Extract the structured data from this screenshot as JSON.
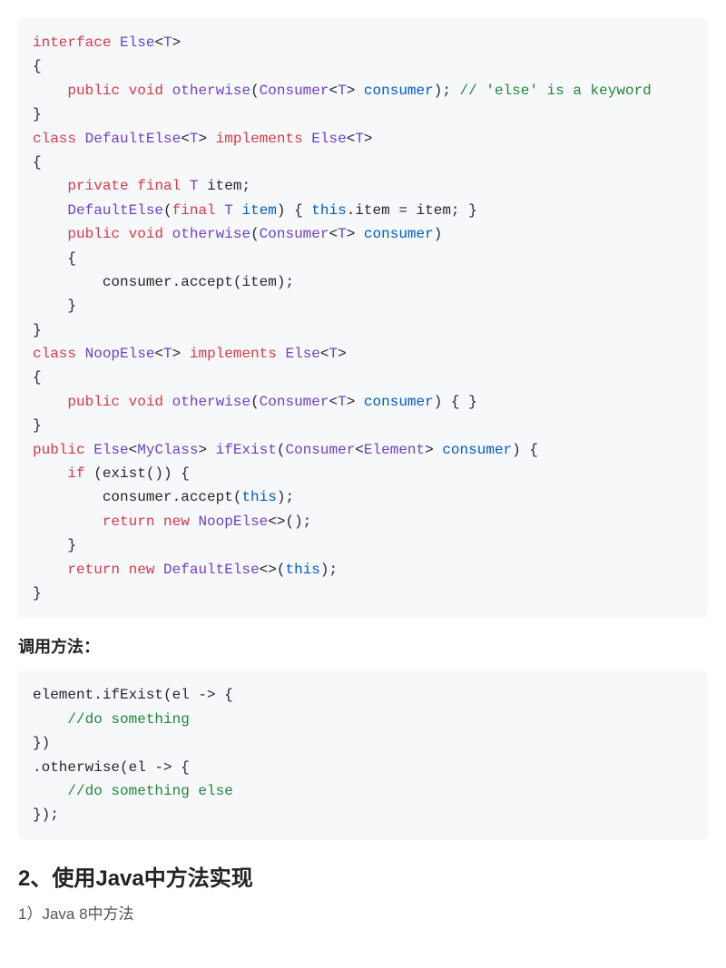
{
  "code1": {
    "l1": {
      "t1": "interface",
      "t2": " ",
      "t3": "Else",
      "t4": "<",
      "t5": "T",
      "t6": ">"
    },
    "l2": {
      "t1": "{"
    },
    "l3": {
      "t1": "    ",
      "t2": "public",
      "t3": " ",
      "t4": "void",
      "t5": " ",
      "t6": "otherwise",
      "t7": "(",
      "t8": "Consumer",
      "t9": "<",
      "t10": "T",
      "t11": "> ",
      "t12": "consumer",
      "t13": "); ",
      "t14": "// 'else' is a keyword"
    },
    "l4": {
      "t1": "}"
    },
    "l5": {
      "t1": "class",
      "t2": " ",
      "t3": "DefaultElse",
      "t4": "<",
      "t5": "T",
      "t6": "> ",
      "t7": "implements",
      "t8": " ",
      "t9": "Else",
      "t10": "<",
      "t11": "T",
      "t12": ">"
    },
    "l6": {
      "t1": "{"
    },
    "l7": {
      "t1": "    ",
      "t2": "private",
      "t3": " ",
      "t4": "final",
      "t5": " ",
      "t6": "T",
      "t7": " item;"
    },
    "l8": {
      "t1": "    ",
      "t2": "DefaultElse",
      "t3": "(",
      "t4": "final",
      "t5": " ",
      "t6": "T",
      "t7": " ",
      "t8": "item",
      "t9": ") { ",
      "t10": "this",
      "t11": ".item = item; }"
    },
    "l9": {
      "t1": "    ",
      "t2": "public",
      "t3": " ",
      "t4": "void",
      "t5": " ",
      "t6": "otherwise",
      "t7": "(",
      "t8": "Consumer",
      "t9": "<",
      "t10": "T",
      "t11": "> ",
      "t12": "consumer",
      "t13": ")"
    },
    "l10": {
      "t1": "    {"
    },
    "l11": {
      "t1": "        consumer.accept(item);"
    },
    "l12": {
      "t1": "    }"
    },
    "l13": {
      "t1": "}"
    },
    "l14": {
      "t1": "class",
      "t2": " ",
      "t3": "NoopElse",
      "t4": "<",
      "t5": "T",
      "t6": "> ",
      "t7": "implements",
      "t8": " ",
      "t9": "Else",
      "t10": "<",
      "t11": "T",
      "t12": ">"
    },
    "l15": {
      "t1": "{"
    },
    "l16": {
      "t1": "    ",
      "t2": "public",
      "t3": " ",
      "t4": "void",
      "t5": " ",
      "t6": "otherwise",
      "t7": "(",
      "t8": "Consumer",
      "t9": "<",
      "t10": "T",
      "t11": "> ",
      "t12": "consumer",
      "t13": ") { }"
    },
    "l17": {
      "t1": "}"
    },
    "l18": {
      "t1": "public",
      "t2": " ",
      "t3": "Else",
      "t4": "<",
      "t5": "MyClass",
      "t6": "> ",
      "t7": "ifExist",
      "t8": "(",
      "t9": "Consumer",
      "t10": "<",
      "t11": "Element",
      "t12": "> ",
      "t13": "consumer",
      "t14": ") {"
    },
    "l19": {
      "t1": "    ",
      "t2": "if",
      "t3": " (exist()) {"
    },
    "l20": {
      "t1": "        consumer.accept(",
      "t2": "this",
      "t3": ");"
    },
    "l21": {
      "t1": "        ",
      "t2": "return",
      "t3": " ",
      "t4": "new",
      "t5": " ",
      "t6": "NoopElse",
      "t7": "<>();"
    },
    "l22": {
      "t1": "    }"
    },
    "l23": {
      "t1": "    ",
      "t2": "return",
      "t3": " ",
      "t4": "new",
      "t5": " ",
      "t6": "DefaultElse",
      "t7": "<>(",
      "t8": "this",
      "t9": ");"
    },
    "l24": {
      "t1": "}"
    }
  },
  "heading1": "调用方法：",
  "code2": {
    "l1": {
      "t1": "element.ifExist(el -> {"
    },
    "l2": {
      "t1": "    ",
      "t2": "//do something"
    },
    "l3": {
      "t1": "})"
    },
    "l4": {
      "t1": ".otherwise(el -> {"
    },
    "l5": {
      "t1": "    ",
      "t2": "//do something else"
    },
    "l6": {
      "t1": "});"
    }
  },
  "heading2": "2、使用Java中方法实现",
  "sub1": "1）Java 8中方法"
}
